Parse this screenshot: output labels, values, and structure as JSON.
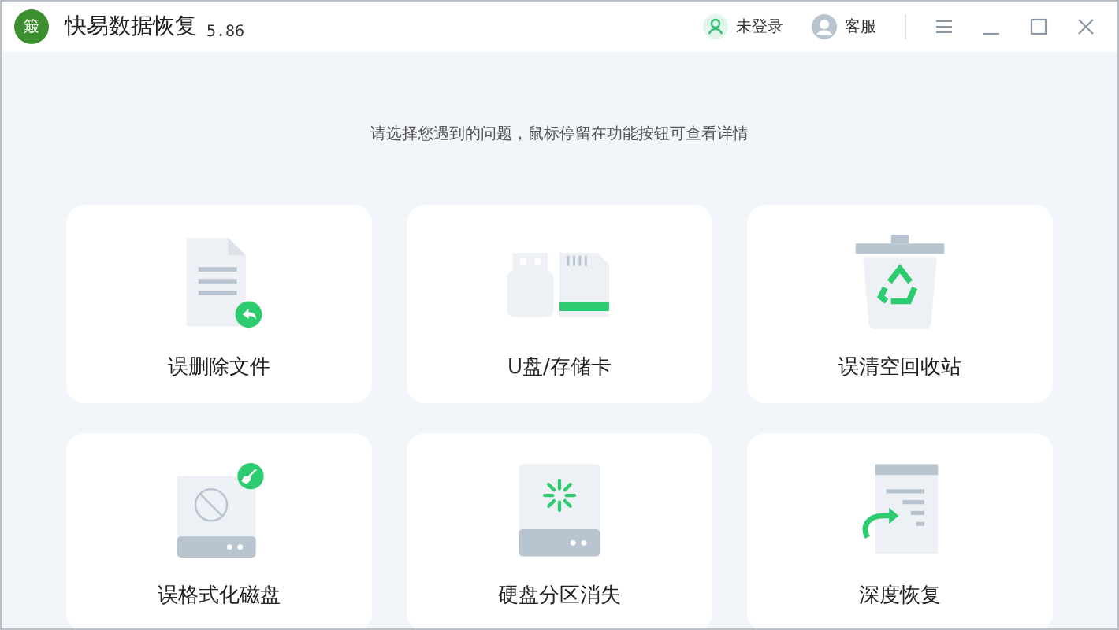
{
  "window": {
    "logo": "簸",
    "title": "快易数据恢复",
    "version": "5.86"
  },
  "header_actions": [
    {
      "kind": "user",
      "label": "未登录"
    },
    {
      "kind": "service",
      "label": "客服"
    }
  ],
  "prompt": "请选择您遇到的问题，鼠标停留在功能按钮可查看详情",
  "options": [
    {
      "kind": "file",
      "label": "误删除文件"
    },
    {
      "kind": "usb",
      "label": "U盘/存储卡"
    },
    {
      "kind": "trash",
      "label": "误清空回收站"
    },
    {
      "kind": "format",
      "label": "误格式化磁盘"
    },
    {
      "kind": "partition",
      "label": "硬盘分区消失"
    },
    {
      "kind": "deep",
      "label": "深度恢复"
    }
  ]
}
